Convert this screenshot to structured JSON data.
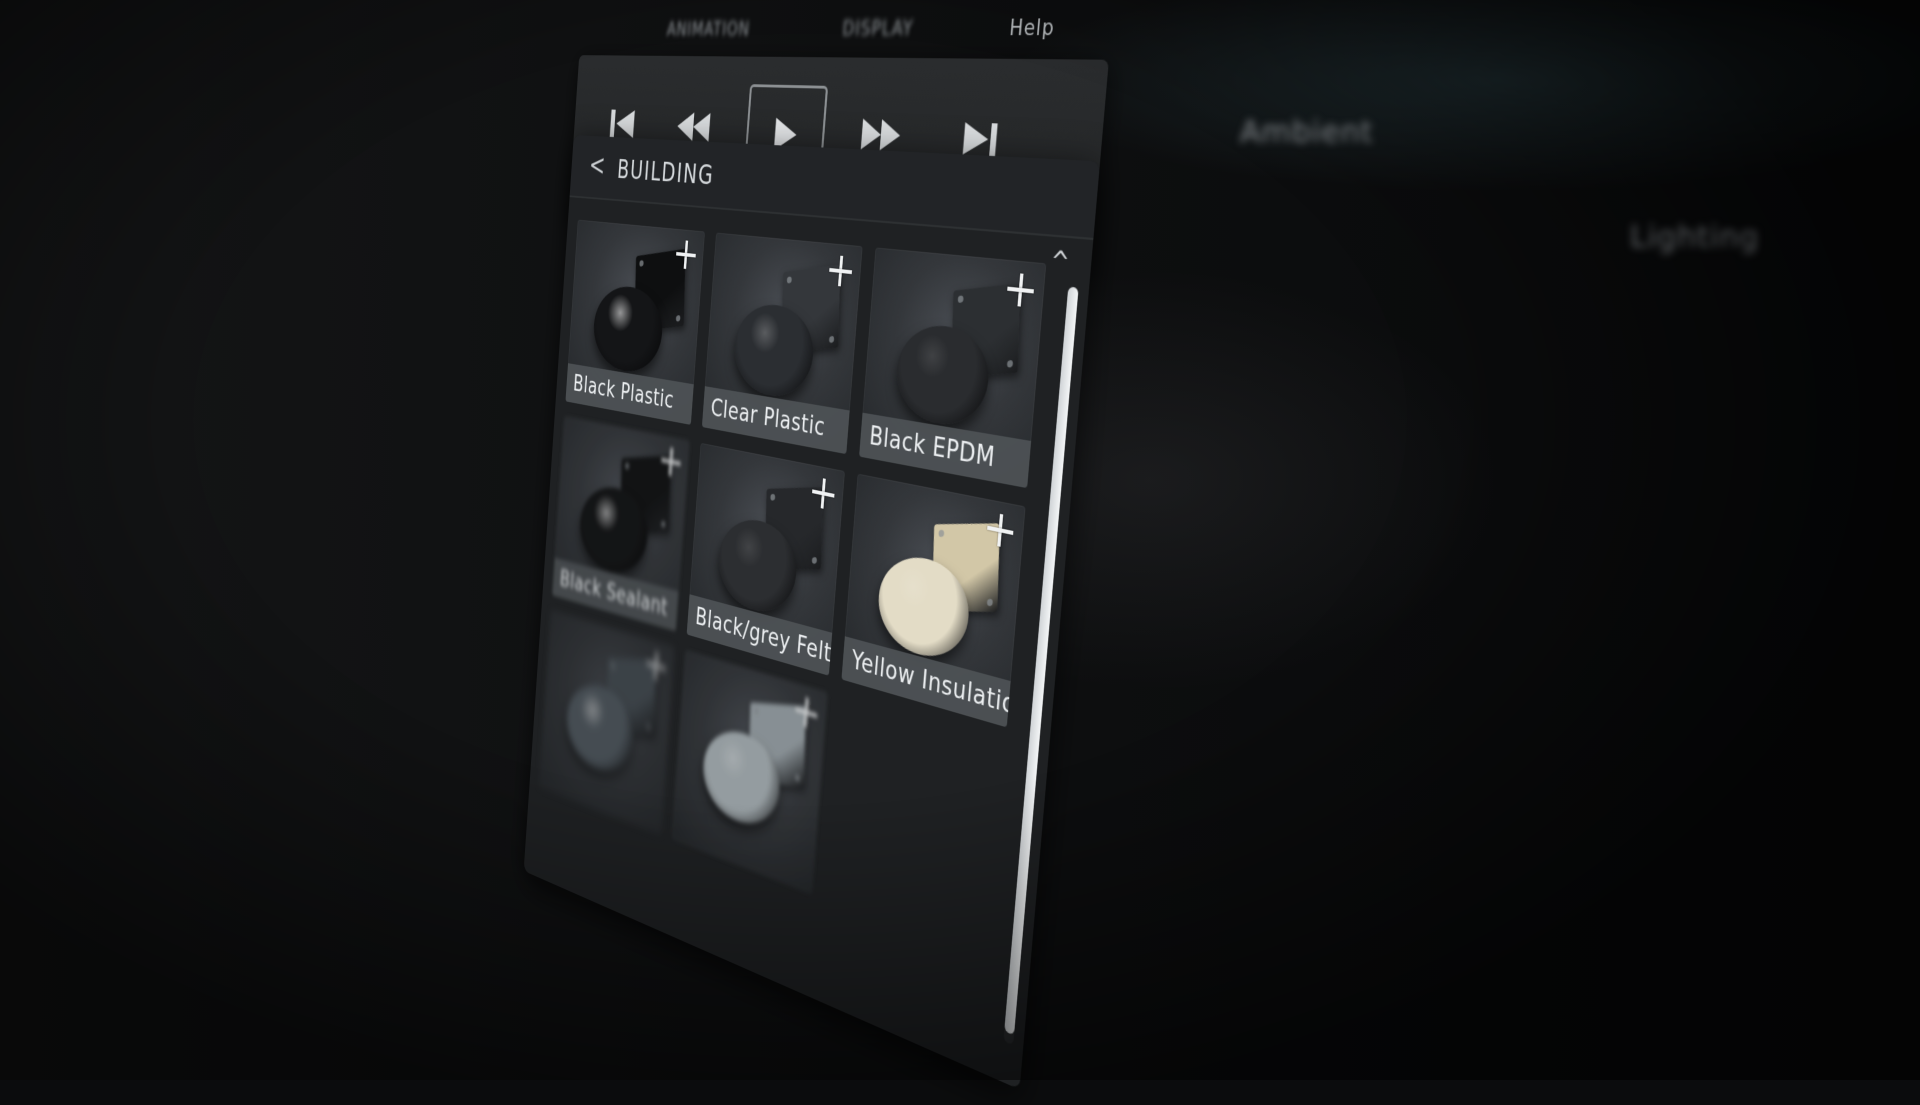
{
  "menu": {
    "left": "ANIMATION",
    "middle": "DISPLAY",
    "help": "Help"
  },
  "background_menu": [
    "Ambient",
    "Lighting"
  ],
  "transport": {
    "buttons": [
      "skip-to-start-icon",
      "rewind-icon",
      "play-icon",
      "fast-forward-icon",
      "skip-to-end-icon"
    ]
  },
  "panel": {
    "back_glyph": "<",
    "title": "BUILDING",
    "collapse_glyph": "^"
  },
  "materials": [
    {
      "label": "Black Plastic",
      "sphere": "#141517",
      "plate": "#0e0f10",
      "sheen": "glossy"
    },
    {
      "label": "Clear Plastic",
      "sphere": "#2b2e32",
      "plate": "#34373b",
      "sheen": "semi"
    },
    {
      "label": "Black EPDM",
      "sphere": "#2a2c2f",
      "plate": "#2c2f32",
      "sheen": "matte"
    },
    {
      "label": "Black Sealant",
      "sphere": "#121314",
      "plate": "#101112",
      "sheen": "glossy"
    },
    {
      "label": "Black/grey Felt",
      "sphere": "#2c2e31",
      "plate": "#26282b",
      "sheen": "matte"
    },
    {
      "label": "Yellow Insulation",
      "sphere": "#e3dcc6",
      "plate": "#d2c7a7",
      "sheen": "matte"
    },
    {
      "label": "",
      "sphere": "#5a646c",
      "plate": "#4b545b",
      "sheen": "glossy"
    },
    {
      "label": "",
      "sphere": "#a9b2b6",
      "plate": "#9aa3a8",
      "sheen": "semi"
    }
  ],
  "colors": {
    "panel_bg": "#1f2123",
    "accent_text": "#eceff1"
  }
}
